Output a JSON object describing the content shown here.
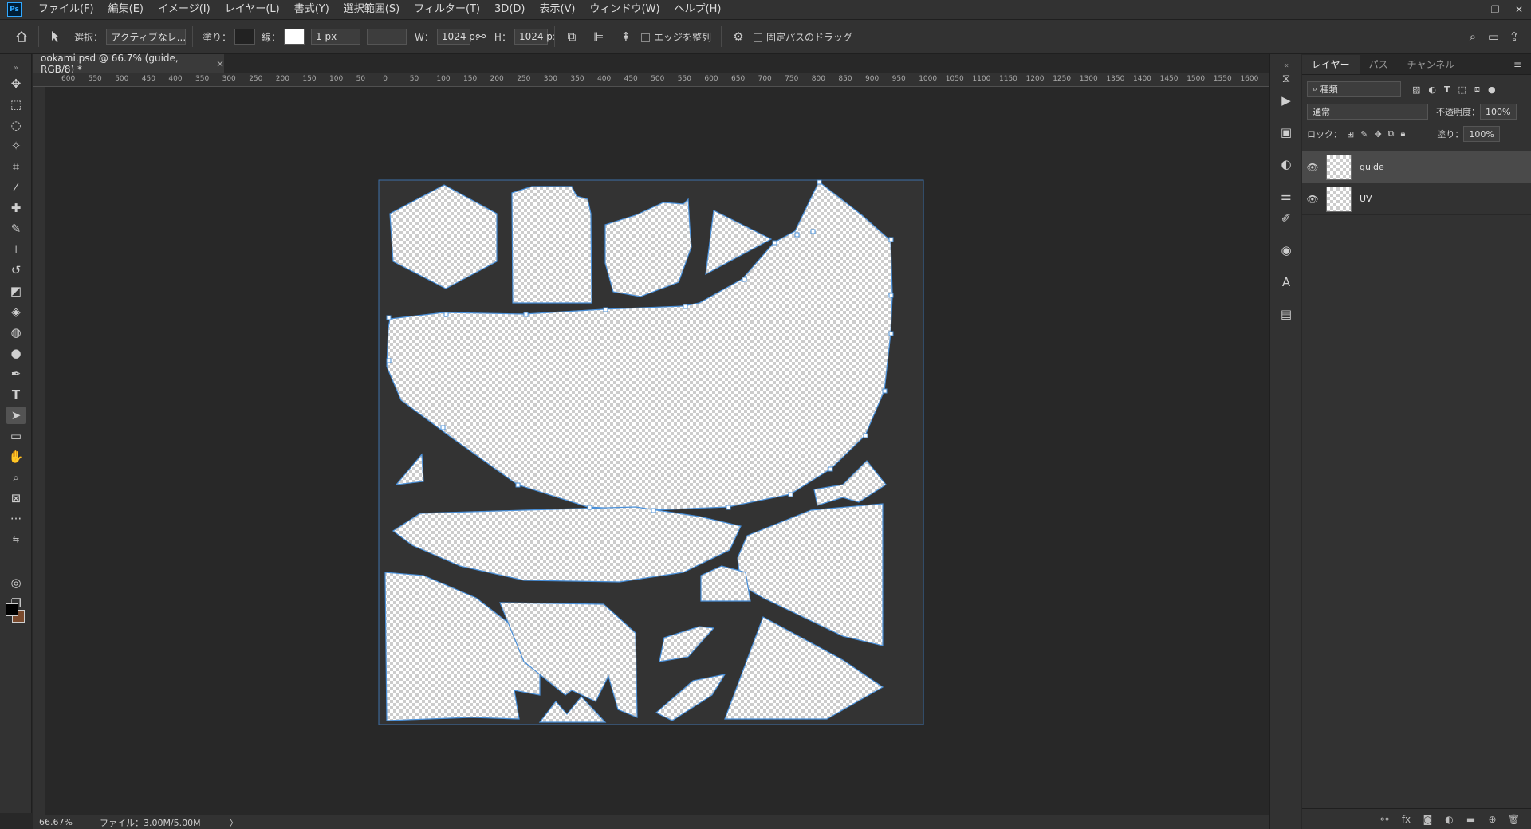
{
  "app": {
    "logo": "Ps"
  },
  "menu": [
    "ファイル(F)",
    "編集(E)",
    "イメージ(I)",
    "レイヤー(L)",
    "書式(Y)",
    "選択範囲(S)",
    "フィルター(T)",
    "3D(D)",
    "表示(V)",
    "ウィンドウ(W)",
    "ヘルプ(H)"
  ],
  "window_controls": {
    "minimize": "–",
    "restore": "❐",
    "close": "✕"
  },
  "options": {
    "select_label": "選択：",
    "select_value": "アクティブなレ...",
    "fill_label": "塗り：",
    "stroke_label": "線：",
    "stroke_width": "1 px",
    "w_label": "W：",
    "w_value": "1024 p:",
    "h_label": "H：",
    "h_value": "1024 p:",
    "align_edges_label": "エッジを整列",
    "fixed_path_label": "固定パスのドラッグ"
  },
  "document": {
    "tab_title": "ookami.psd @ 66.7% (guide, RGB/8) *",
    "tab_close": "×"
  },
  "ruler_h": [
    "600",
    "550",
    "500",
    "450",
    "400",
    "350",
    "300",
    "250",
    "200",
    "150",
    "100",
    "50",
    "0",
    "50",
    "100",
    "150",
    "200",
    "250",
    "300",
    "350",
    "400",
    "450",
    "500",
    "550",
    "600",
    "650",
    "700",
    "750",
    "800",
    "850",
    "900",
    "950",
    "1000",
    "1050",
    "1100",
    "1150",
    "1200",
    "1250",
    "1300",
    "1350",
    "1400",
    "1450",
    "1500",
    "1550",
    "1600"
  ],
  "status": {
    "zoom": "66.67%",
    "file": "ファイル：3.00M/5.00M",
    "arrow": "〉"
  },
  "panel": {
    "tabs": [
      "レイヤー",
      "パス",
      "チャンネル"
    ],
    "kind_filter": "種類",
    "blend_mode": "通常",
    "opacity_label": "不透明度：",
    "opacity_value": "100%",
    "lock_label": "ロック：",
    "fill_label": "塗り：",
    "fill_value": "100%",
    "layers": [
      {
        "name": "guide",
        "selected": true
      },
      {
        "name": "UV",
        "selected": false
      }
    ]
  },
  "colors": {
    "accent": "#31a8ff",
    "path": "#4a90d9",
    "canvas_bg": "#333333"
  }
}
